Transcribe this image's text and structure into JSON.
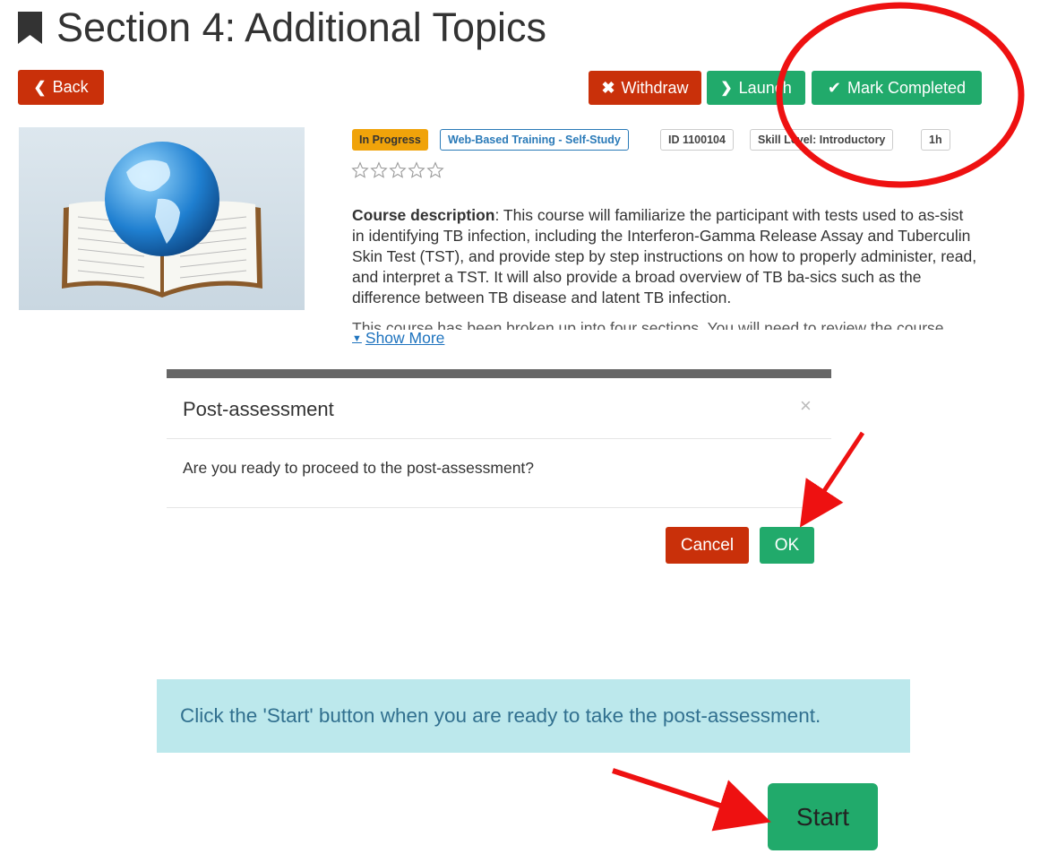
{
  "page": {
    "title": "Section 4: Additional Topics",
    "icon": "bookmark-icon"
  },
  "toolbar": {
    "back_label": "Back",
    "withdraw_label": "Withdraw",
    "launch_label": "Launch",
    "mark_completed_label": "Mark Completed"
  },
  "course": {
    "image": "globe-on-book-image",
    "badges": {
      "status": "In Progress",
      "type": "Web-Based Training - Self-Study",
      "id": "ID 1100104",
      "skill": "Skill Level: Introductory",
      "duration": "1h"
    },
    "rating_stars": 0,
    "rating_max": 5,
    "description_label": "Course description",
    "description_text": ": This course will familiarize the participant with tests used to as-sist in identifying TB infection, including the Interferon-Gamma Release Assay and Tuberculin Skin Test (TST), and provide step by step instructions on how to properly administer, read, and interpret a TST. It will also provide a broad overview of TB ba-sics such as the difference between TB disease and latent TB infection.",
    "description_more": "This course has been broken up into four sections. You will need to review the course",
    "show_more_label": "Show More"
  },
  "modal": {
    "title": "Post-assessment",
    "close_symbol": "×",
    "body": "Are you ready to proceed to the post-assessment?",
    "cancel_label": "Cancel",
    "ok_label": "OK"
  },
  "assessment": {
    "info_text": "Click the 'Start' button when you are ready to take the post-assessment.",
    "start_label": "Start"
  },
  "colors": {
    "red_button": "#c9300a",
    "green_button": "#21aa6b",
    "badge_orange": "#f0a30a",
    "badge_blue": "#2a7ab8",
    "alert_bg": "#bce8ec",
    "annotation_red": "#ee1111"
  }
}
